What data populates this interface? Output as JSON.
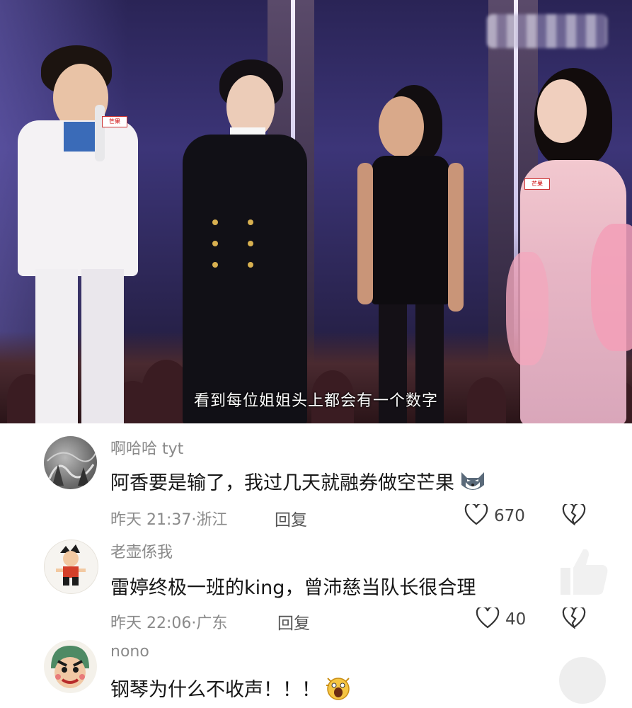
{
  "video": {
    "subtitle": "看到每位姐姐头上都会有一个数字",
    "mic_label": "芒果"
  },
  "comments": [
    {
      "username": "啊哈哈 tyt",
      "text": "阿香要是输了，我过几天就融券做空芒果",
      "emoji": "wolf-face-emoji",
      "time": "昨天 21:37",
      "location": "浙江",
      "reply_label": "回复",
      "likes": "670"
    },
    {
      "username": "老壶係我",
      "text": "雷婷终极一班的king，曾沛慈当队长很合理",
      "time": "昨天 22:06",
      "location": "广东",
      "reply_label": "回复",
      "likes": "40"
    },
    {
      "username": "nono",
      "text": "钢琴为什么不收声！！！",
      "emoji": "screaming-face-emoji"
    }
  ],
  "colors": {
    "meta_gray": "#8a8a8a",
    "text_dark": "#161616"
  }
}
